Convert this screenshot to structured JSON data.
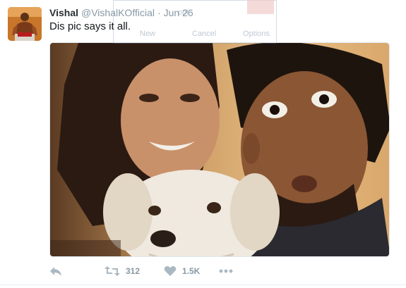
{
  "tweet": {
    "display_name": "Vishal",
    "handle": "@VishalKOfficial",
    "separator": "·",
    "date": "Jun 26",
    "text": "Dis pic says it all."
  },
  "actions": {
    "retweet_count": "312",
    "like_count": "1.5K"
  },
  "overlay_window": {
    "title": "ool",
    "new_label": "New",
    "cancel_label": "Cancel",
    "options_label": "Options"
  },
  "colors": {
    "name": "#292f33",
    "meta": "#8899a6",
    "action_icon": "#aab8c2"
  },
  "icons": [
    "reply-icon",
    "retweet-icon",
    "heart-icon",
    "more-icon"
  ]
}
